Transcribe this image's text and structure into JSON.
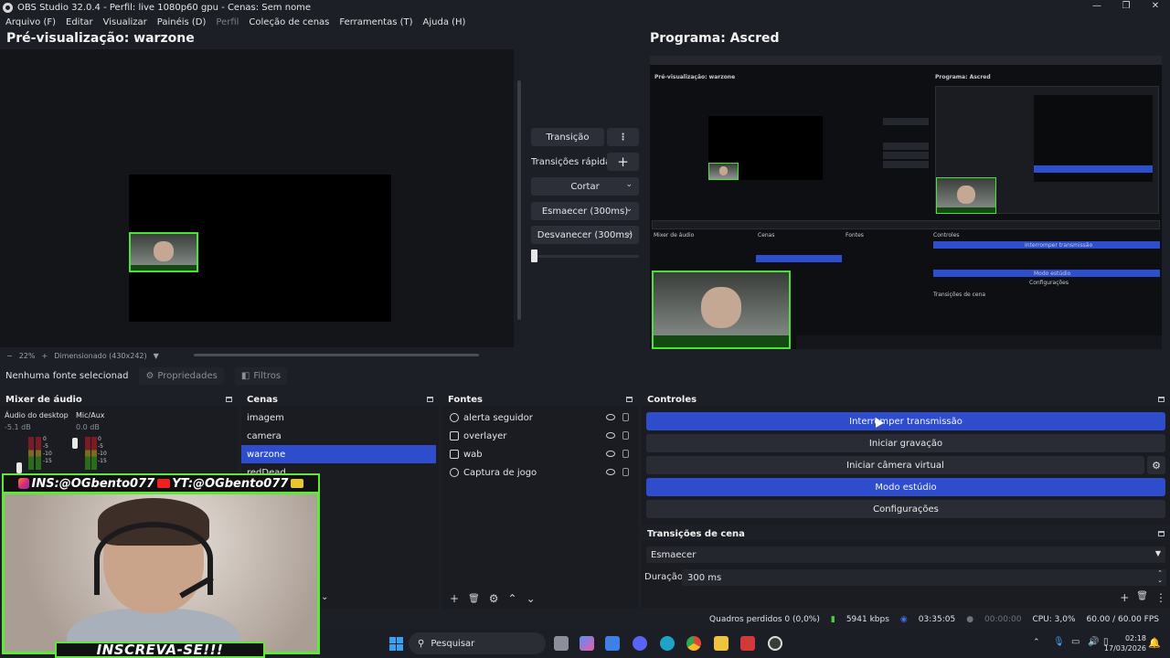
{
  "window": {
    "title": "OBS Studio 32.0.4 - Perfil: live 1080p60 gpu - Cenas: Sem nome",
    "controls": [
      "—",
      "❐",
      "✕"
    ]
  },
  "menu": [
    "Arquivo (F)",
    "Editar",
    "Visualizar",
    "Painéis (D)",
    "Perfil",
    "Coleção de cenas",
    "Ferramentas (T)",
    "Ajuda (H)"
  ],
  "preview": {
    "title": "Pré-visualização: warzone",
    "zoom_minus": "−",
    "zoom": "22%",
    "zoom_plus": "+",
    "scale_label": "Dimensionado (430x242)"
  },
  "program": {
    "title": "Programa: Ascred",
    "nested_labels": {
      "preview": "Pré-visualização: warzone",
      "program": "Programa: Ascred",
      "mixer": "Mixer de áudio",
      "scenes": "Cenas",
      "sources": "Fontes",
      "controls": "Controles",
      "stop": "Interromper transmissão",
      "studio": "Modo estúdio",
      "config": "Configurações",
      "transitions": "Transições de cena"
    }
  },
  "transition_panel": {
    "transition_button": "Transição",
    "quick_transitions": "Transições rápidas",
    "add": "+",
    "quick": [
      "Cortar",
      "Esmaecer (300ms)",
      "Desvanecer (300ms)"
    ]
  },
  "source_toolbar": {
    "no_source": "Nenhuma fonte selecionad",
    "properties": "Propriedades",
    "filters": "Filtros"
  },
  "mixer": {
    "title": "Mixer de áudio",
    "channels": [
      {
        "name": "Áudio do desktop",
        "db": "-5.1 dB"
      },
      {
        "name": "Mic/Aux",
        "db": "0.0 dB"
      }
    ],
    "scale": [
      "0",
      "-5",
      "-10",
      "-15"
    ]
  },
  "scenes": {
    "title": "Cenas",
    "items": [
      "imagem",
      "camera",
      "warzone",
      "redDead"
    ],
    "selected": 2
  },
  "sources": {
    "title": "Fontes",
    "items": [
      "alerta seguidor",
      "overlayer",
      "wab",
      "Captura de jogo"
    ],
    "footer": [
      "+",
      "🗑",
      "⚙",
      "⌃",
      "⌄"
    ]
  },
  "controls": {
    "title": "Controles",
    "buttons": [
      "Interromper transmissão",
      "Iniciar gravação",
      "Iniciar câmera virtual",
      "Modo estúdio",
      "Configurações"
    ]
  },
  "scene_transitions": {
    "title": "Transições de cena",
    "selected": "Esmaecer",
    "duration_label": "Duração",
    "duration_value": "300 ms"
  },
  "status": {
    "dropped": "Quadros perdidos 0 (0,0%)",
    "bitrate": "5941 kbps",
    "live_time": "03:35:05",
    "rec_time": "00:00:00",
    "cpu": "CPU: 3,0%",
    "fps": "60.00 / 60.00 FPS"
  },
  "taskbar": {
    "search": "Pesquisar",
    "time": "02:18",
    "date": "17/03/2026"
  },
  "webcam_overlay": {
    "instagram": "INS:@OGbento077",
    "youtube": "YT:@OGbento077",
    "cta": "INSCREVA-SE!!!"
  },
  "colors": {
    "accent": "#2e4dcc",
    "panel": "#1b1c22",
    "background": "#1d1f26",
    "overlay_green": "#5ee839"
  }
}
